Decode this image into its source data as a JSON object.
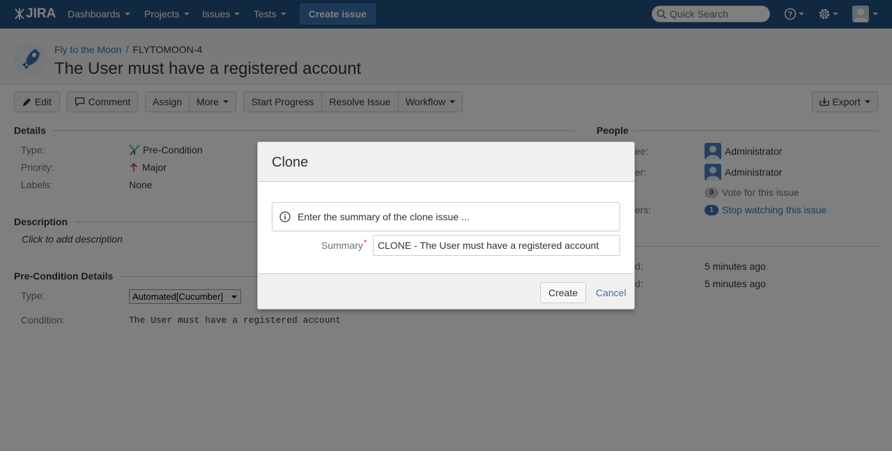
{
  "topnav": {
    "logo": "JIRA",
    "dashboards": "Dashboards",
    "projects": "Projects",
    "issues": "Issues",
    "tests": "Tests",
    "create_issue": "Create issue",
    "search_placeholder": "Quick Search"
  },
  "header": {
    "project": "Fly to the Moon",
    "separator": "/",
    "issue_key": "FLYTOMOON-4",
    "summary": "The User must have a registered account"
  },
  "toolbar": {
    "edit": "Edit",
    "comment": "Comment",
    "assign": "Assign",
    "more": "More",
    "start_progress": "Start Progress",
    "resolve_issue": "Resolve Issue",
    "workflow": "Workflow",
    "export": "Export"
  },
  "details": {
    "heading": "Details",
    "type_label": "Type:",
    "type_value": "Pre-Condition",
    "priority_label": "Priority:",
    "priority_value": "Major",
    "labels_label": "Labels:",
    "labels_value": "None"
  },
  "description": {
    "heading": "Description",
    "placeholder": "Click to add description"
  },
  "precondition": {
    "heading": "Pre-Condition Details",
    "type_label": "Type:",
    "type_value": "Automated[Cucumber]",
    "condition_label": "Condition:",
    "condition_value": "The User must have a registered account"
  },
  "people": {
    "heading": "People",
    "assignee_label_partial": "ee:",
    "assignee": "Administrator",
    "reporter_label_partial": "er:",
    "reporter": "Administrator",
    "votes_count": "0",
    "votes_text": "Vote for this issue",
    "watchers_label_partial": "ers:",
    "watchers_count": "1",
    "watchers_text": "Stop watching this issue"
  },
  "dates": {
    "created_label_partial": "d:",
    "created": "5 minutes ago",
    "updated_label_partial": "d:",
    "updated": "5 minutes ago"
  },
  "dialog": {
    "title": "Clone",
    "info": "Enter the summary of the clone issue ...",
    "summary_label": "Summary",
    "required_mark": "*",
    "summary_value": "CLONE - The User must have a registered account",
    "create_button": "Create",
    "cancel_link": "Cancel"
  },
  "colors": {
    "nav_bg": "#205081",
    "link": "#3b73af",
    "create_btn": "#3b73af"
  }
}
